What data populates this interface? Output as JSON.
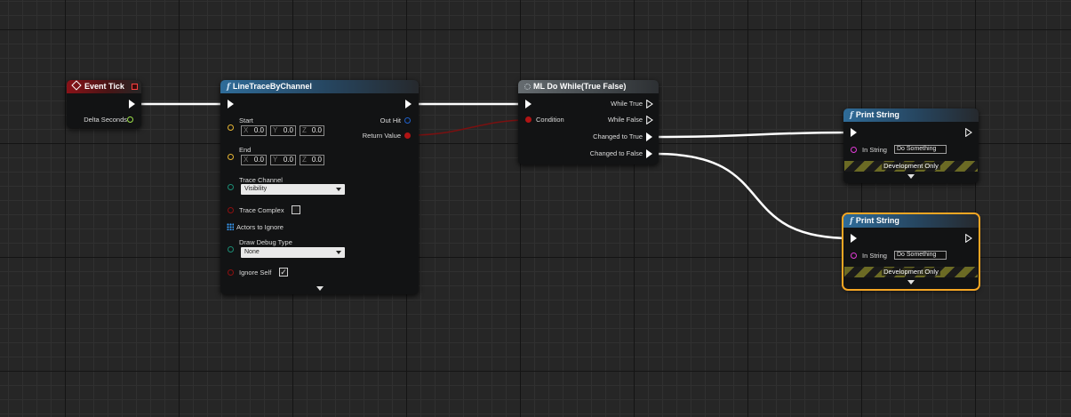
{
  "colors": {
    "exec": "#ffffff",
    "event_header": "#8a1218",
    "function_header": "#2f6c99",
    "macro_header": "#666c70",
    "float_pin": "#9ee34a",
    "vector_pin": "#e6b534",
    "byte_pin": "#1c8c74",
    "bool_pin": "#8c1010",
    "struct_pin": "#1f60c9",
    "object_pin": "#39a0ff",
    "string_pin": "#e23bd7",
    "selected_outline": "#f5a623",
    "bool_wire": "#7a1010"
  },
  "nodes": {
    "event_tick": {
      "title": "Event Tick",
      "icon": "event-diamond-icon",
      "delta_seconds_label": "Delta Seconds"
    },
    "line_trace": {
      "title": "LineTraceByChannel",
      "icon": "function-f-icon",
      "start_label": "Start",
      "start": {
        "x_label": "X",
        "x": "0.0",
        "y_label": "Y",
        "y": "0.0",
        "z_label": "Z",
        "z": "0.0"
      },
      "end_label": "End",
      "end": {
        "x_label": "X",
        "x": "0.0",
        "y_label": "Y",
        "y": "0.0",
        "z_label": "Z",
        "z": "0.0"
      },
      "trace_channel_label": "Trace Channel",
      "trace_channel_value": "Visibility",
      "trace_complex_label": "Trace Complex",
      "trace_complex_checked": false,
      "actors_to_ignore_label": "Actors to Ignore",
      "draw_debug_type_label": "Draw Debug Type",
      "draw_debug_type_value": "None",
      "ignore_self_label": "Ignore Self",
      "ignore_self_checked": true,
      "ignore_self_check_glyph": "✓",
      "out_hit_label": "Out Hit",
      "return_value_label": "Return Value"
    },
    "do_while": {
      "title": "ML Do While(True False)",
      "icon": "macro-gear-icon",
      "condition_label": "Condition",
      "while_true_label": "While True",
      "while_false_label": "While False",
      "changed_true_label": "Changed to True",
      "changed_false_label": "Changed to False"
    },
    "print_string_1": {
      "title": "Print String",
      "icon": "function-f-icon",
      "in_string_label": "In String",
      "in_string_value": "Do Something",
      "dev_only_label": "Development Only"
    },
    "print_string_2": {
      "title": "Print String",
      "icon": "function-f-icon",
      "in_string_label": "In String",
      "in_string_value": "Do Something",
      "dev_only_label": "Development Only",
      "selected": true
    }
  }
}
